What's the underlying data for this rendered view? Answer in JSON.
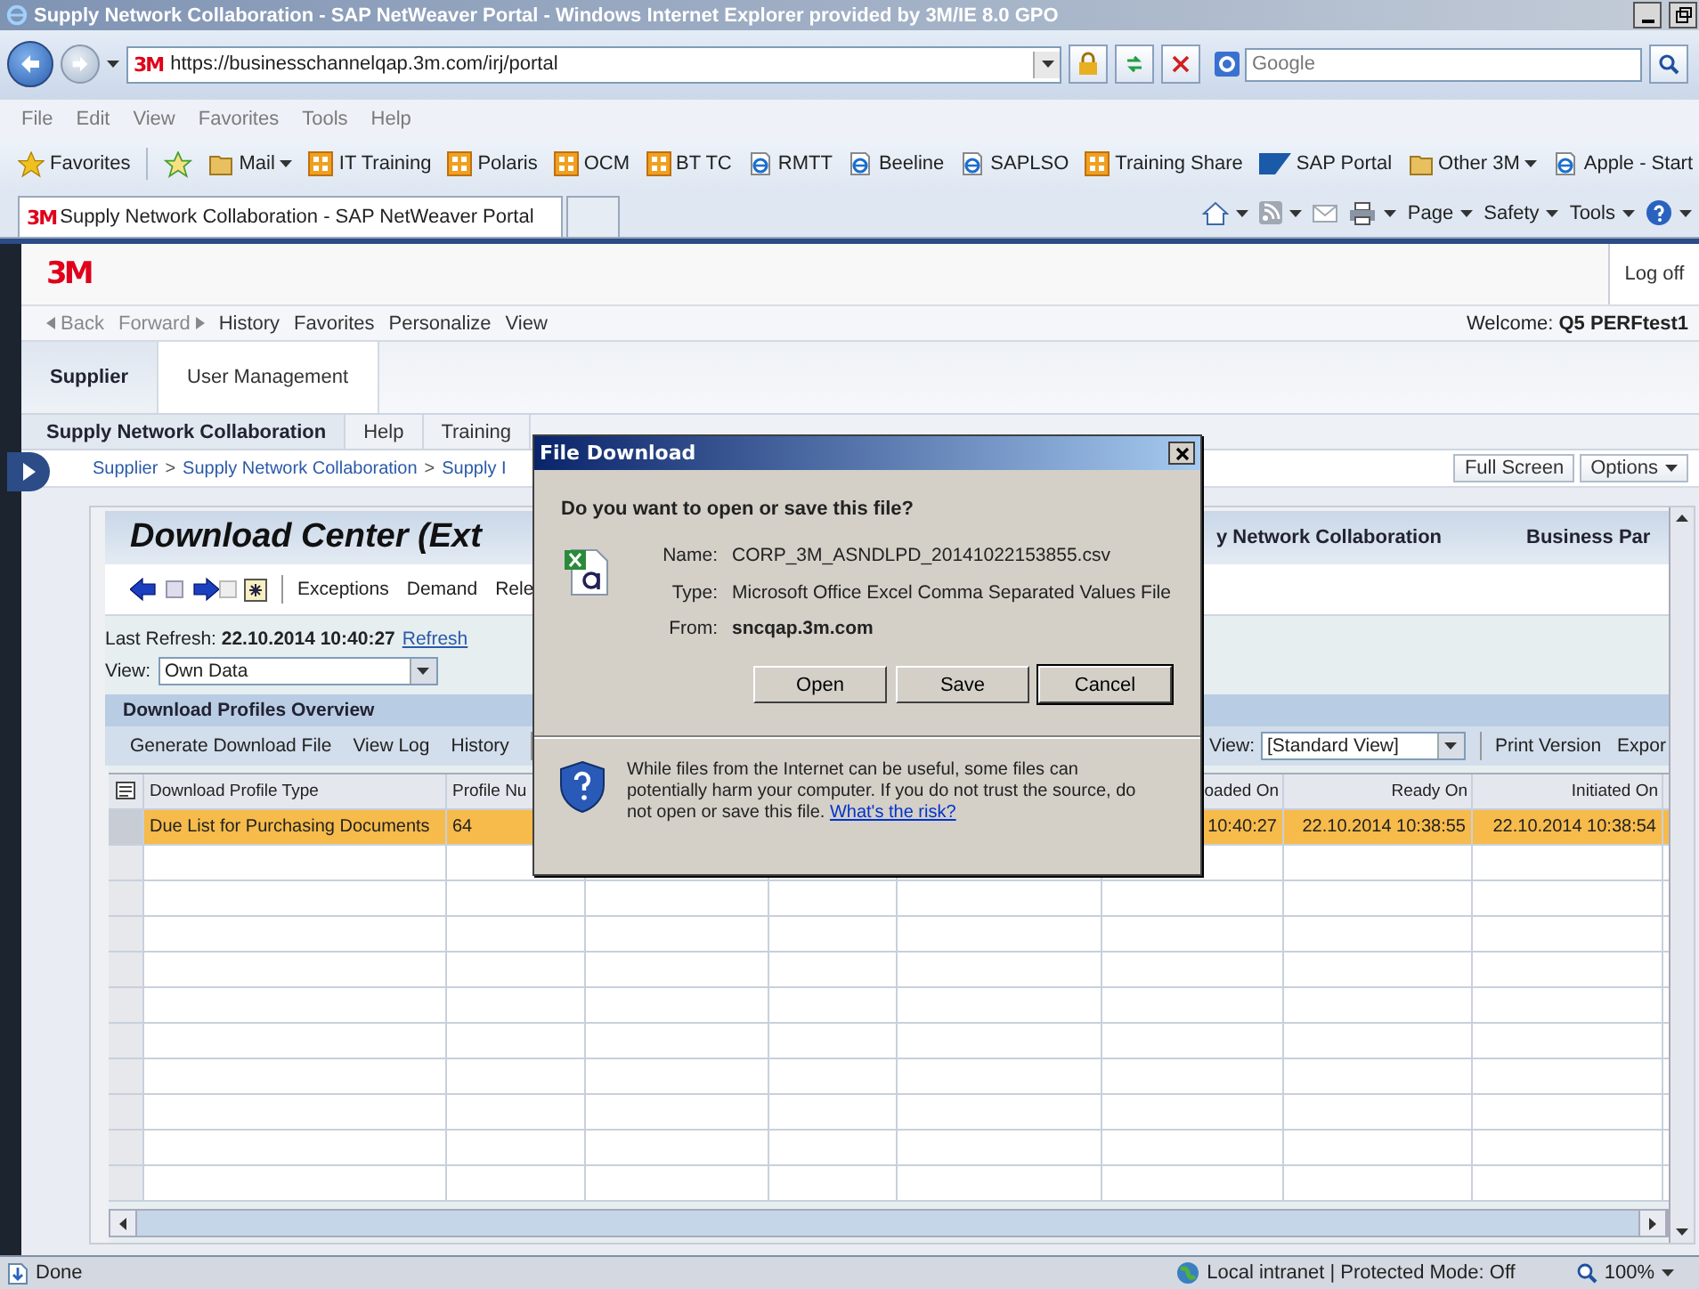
{
  "browser": {
    "title": "Supply Network Collaboration - SAP NetWeaver Portal - Windows Internet Explorer provided by 3M/IE 8.0 GPO",
    "address": {
      "logo": "3M",
      "url": "https://businesschannelqap.3m.com/irj/portal"
    },
    "search": {
      "placeholder": "Google"
    },
    "menu": [
      "File",
      "Edit",
      "View",
      "Favorites",
      "Tools",
      "Help"
    ],
    "favorites_label": "Favorites",
    "favorites": [
      {
        "label": "Mail",
        "kind": "folder",
        "dropdown": true
      },
      {
        "label": "IT Training",
        "kind": "apps",
        "dropdown": false
      },
      {
        "label": "Polaris",
        "kind": "apps",
        "dropdown": false
      },
      {
        "label": "OCM",
        "kind": "apps",
        "dropdown": false
      },
      {
        "label": "BT TC",
        "kind": "apps",
        "dropdown": false
      },
      {
        "label": "RMTT",
        "kind": "page",
        "dropdown": false
      },
      {
        "label": "Beeline",
        "kind": "page",
        "dropdown": false
      },
      {
        "label": "SAPLSO",
        "kind": "page",
        "dropdown": false
      },
      {
        "label": "Training Share",
        "kind": "apps",
        "dropdown": false
      },
      {
        "label": "SAP Portal",
        "kind": "sap",
        "dropdown": false
      },
      {
        "label": "Other 3M",
        "kind": "folder",
        "dropdown": true
      },
      {
        "label": "Apple - Start",
        "kind": "page",
        "dropdown": false
      }
    ],
    "tab": {
      "logo": "3M",
      "title": "Supply Network Collaboration - SAP NetWeaver Portal"
    },
    "commands": [
      "Page",
      "Safety",
      "Tools"
    ]
  },
  "portal": {
    "logo": "3M",
    "logoff": "Log off",
    "nav": [
      {
        "label": "Back",
        "kind": "back"
      },
      {
        "label": "Forward",
        "kind": "forward"
      },
      {
        "label": "History",
        "kind": "link"
      },
      {
        "label": "Favorites",
        "kind": "link"
      },
      {
        "label": "Personalize",
        "kind": "link"
      },
      {
        "label": "View",
        "kind": "link"
      }
    ],
    "welcome": "Welcome:",
    "user": "Q5 PERFtest1",
    "tabs": [
      {
        "label": "Supplier",
        "selected": true
      },
      {
        "label": "User Management",
        "selected": false
      }
    ],
    "subtabs": [
      {
        "label": "Supply Network Collaboration",
        "selected": true
      },
      {
        "label": "Help",
        "selected": false
      },
      {
        "label": "Training",
        "selected": false
      }
    ],
    "breadcrumb": [
      "Supplier",
      "Supply Network Collaboration",
      "Supply I"
    ],
    "breadcrumb_separator": ">",
    "page_buttons": [
      {
        "label": "Full Screen",
        "dropdown": false
      },
      {
        "label": "Options",
        "dropdown": true
      }
    ]
  },
  "app": {
    "title": "Download Center (Ext",
    "header_right": [
      "y Network Collaboration",
      "Business Par"
    ],
    "toolbar": [
      "Exceptions",
      "Demand",
      "Rele"
    ],
    "last_refresh": {
      "label": "Last Refresh:",
      "value": "22.10.2014 10:40:27",
      "link": "Refresh"
    },
    "view": {
      "label": "View:",
      "value": "Own Data"
    },
    "overview": {
      "title": "Download Profiles Overview",
      "actions": [
        "Generate Download File",
        "View Log",
        "History"
      ],
      "view_label": "View:",
      "view_value": "[Standard View]",
      "right_actions": [
        "Print Version",
        "Expor"
      ]
    },
    "table": {
      "columns": [
        {
          "label": "Download Profile Type"
        },
        {
          "label": "Profile Nu"
        },
        {},
        {},
        {},
        {
          "label": "oaded On"
        },
        {
          "label": "Ready On"
        },
        {
          "label": "Initiated On"
        }
      ],
      "rows": [
        {
          "selected": true,
          "cells": [
            "Due List for Purchasing Documents",
            "64",
            null,
            null,
            null,
            "10:40:27",
            "22.10.2014 10:38:55",
            "22.10.2014 10:38:54"
          ]
        }
      ]
    }
  },
  "dialog": {
    "title": "File Download",
    "question": "Do you want to open or save this file?",
    "fields": [
      {
        "label": "Name:",
        "value": "CORP_3M_ASNDLPD_20141022153855.csv",
        "bold": false
      },
      {
        "label": "Type:",
        "value": "Microsoft Office Excel Comma Separated Values File",
        "bold": false
      },
      {
        "label": "From:",
        "value": "sncqap.3m.com",
        "bold": true
      }
    ],
    "buttons": [
      {
        "label": "Open",
        "default": false
      },
      {
        "label": "Save",
        "default": false
      },
      {
        "label": "Cancel",
        "default": true
      }
    ],
    "warning": "While files from the Internet can be useful, some files can potentially harm your computer. If you do not trust the source, do not open or save this file.",
    "warning_link": "What's the risk?"
  },
  "status_bar": {
    "text": "Done",
    "zone": "Local intranet | Protected Mode: Off",
    "zoom": "100%"
  }
}
